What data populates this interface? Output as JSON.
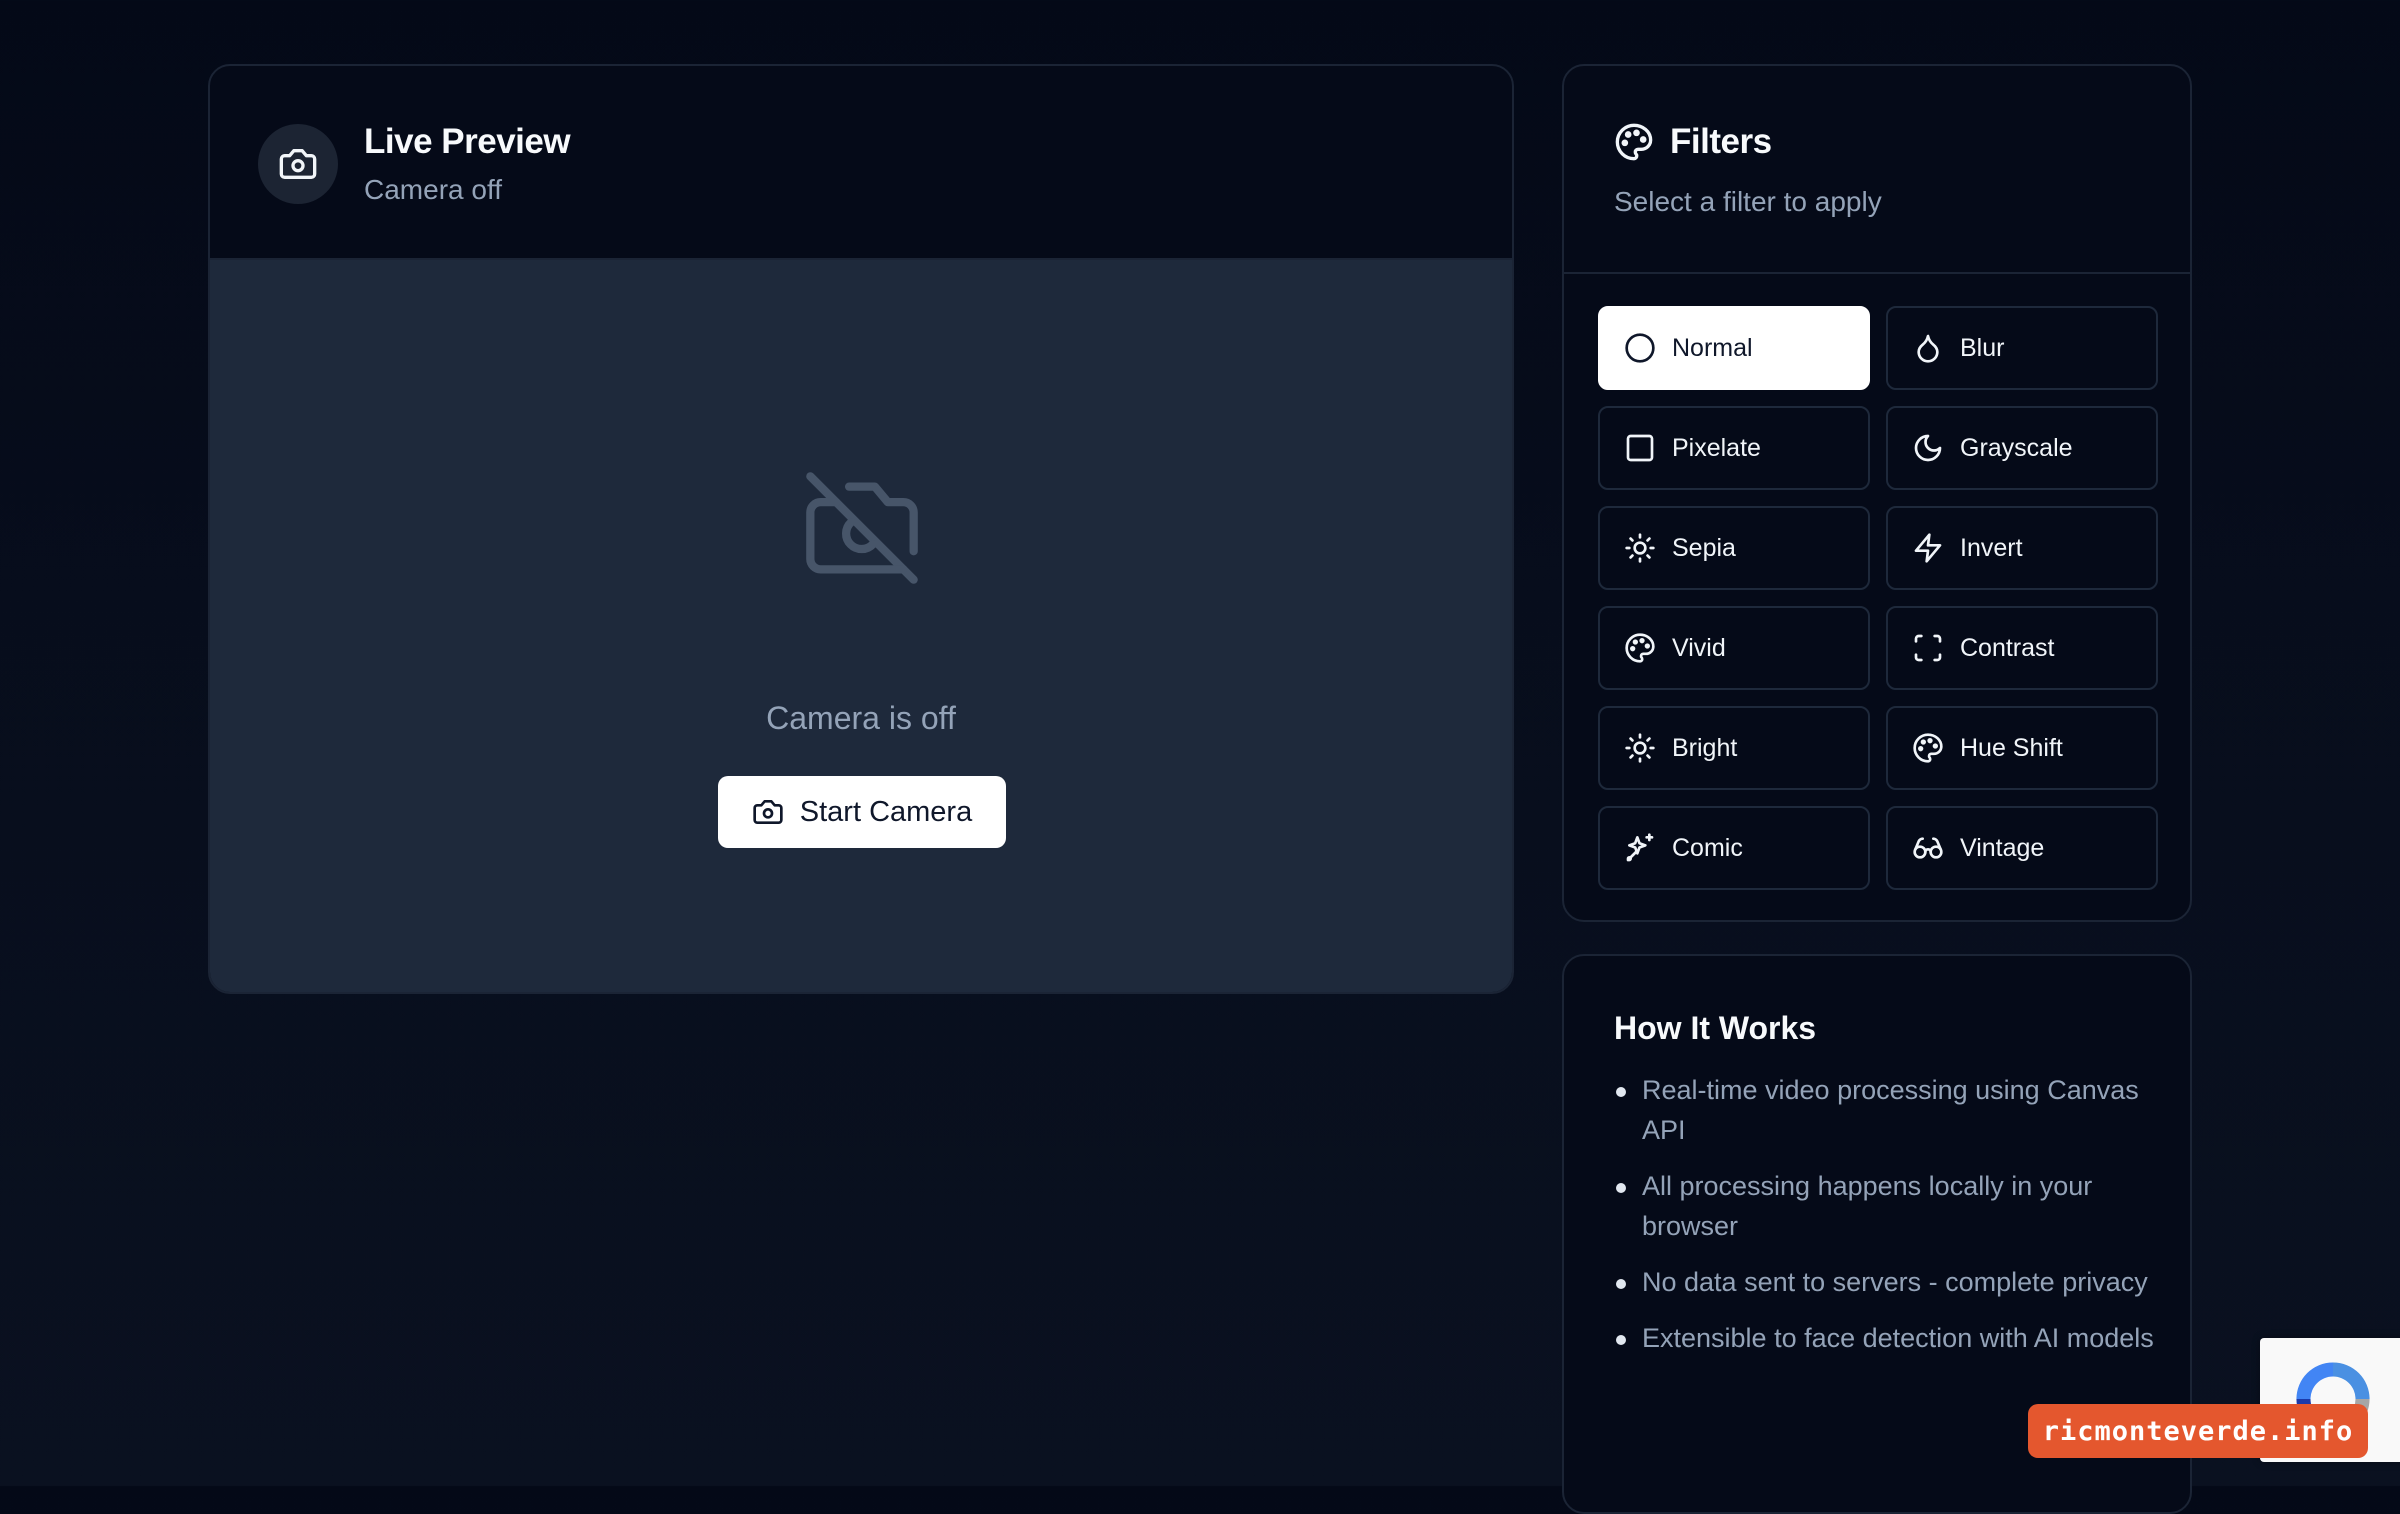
{
  "preview": {
    "title": "Live Preview",
    "status": "Camera off",
    "empty_message": "Camera is off",
    "start_button_label": "Start Camera"
  },
  "filters": {
    "title": "Filters",
    "subtitle": "Select a filter to apply",
    "selected": "Normal",
    "items": [
      {
        "label": "Normal",
        "icon": "circle-icon"
      },
      {
        "label": "Blur",
        "icon": "droplet-icon"
      },
      {
        "label": "Pixelate",
        "icon": "square-icon"
      },
      {
        "label": "Grayscale",
        "icon": "moon-icon"
      },
      {
        "label": "Sepia",
        "icon": "sun-icon"
      },
      {
        "label": "Invert",
        "icon": "zap-icon"
      },
      {
        "label": "Vivid",
        "icon": "palette-icon"
      },
      {
        "label": "Contrast",
        "icon": "scan-icon"
      },
      {
        "label": "Bright",
        "icon": "sun-icon"
      },
      {
        "label": "Hue Shift",
        "icon": "palette-icon"
      },
      {
        "label": "Comic",
        "icon": "sparkles-icon"
      },
      {
        "label": "Vintage",
        "icon": "glasses-icon"
      }
    ]
  },
  "how_it_works": {
    "title": "How It Works",
    "items": [
      "Real-time video processing using Canvas API",
      "All processing happens locally in your browser",
      "No data sent to servers - complete privacy",
      "Extensible to face detection with AI models"
    ]
  },
  "watermark": {
    "text": "ricmonteverde.info"
  },
  "colors": {
    "background": "#040917",
    "card": "#050a18",
    "stage": "#1e293b",
    "border": "#1b2435",
    "muted_text": "#94a3b8",
    "selected_button": "#ffffff",
    "watermark": "#e4572e"
  }
}
